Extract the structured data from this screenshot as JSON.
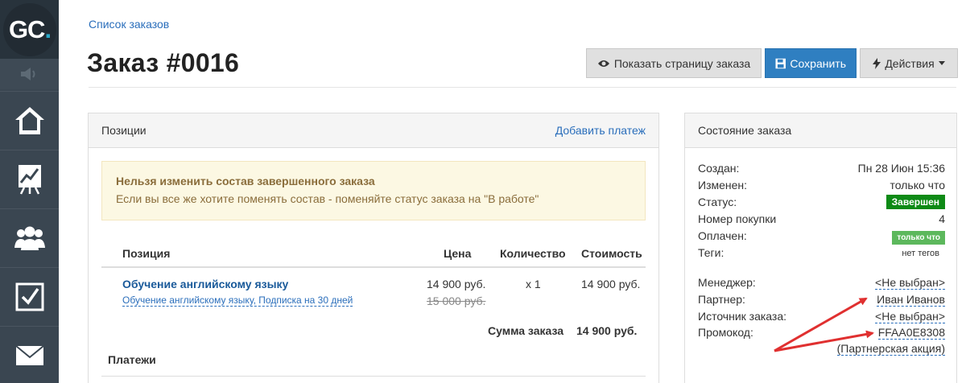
{
  "app": {
    "logo_text": "GC",
    "logo_dot": "."
  },
  "sidebar": {
    "items": [
      {
        "icon": "speaker-icon"
      },
      {
        "icon": "home-icon"
      },
      {
        "icon": "chart-icon"
      },
      {
        "icon": "users-icon"
      },
      {
        "icon": "checkbox-icon"
      },
      {
        "icon": "mail-icon"
      }
    ]
  },
  "header": {
    "breadcrumb": "Список заказов",
    "title": "Заказ #0016",
    "buttons": {
      "show_page": "Показать страницу заказа",
      "save": "Сохранить",
      "actions": "Действия"
    }
  },
  "positions_panel": {
    "title": "Позиции",
    "add_payment": "Добавить платеж",
    "alert_title": "Нельзя изменить состав завершенного заказа",
    "alert_text": "Если вы все же хотите поменять состав - поменяйте статус заказа на \"В работе\"",
    "columns": [
      "Позиция",
      "Цена",
      "Количество",
      "Стоимость"
    ],
    "rows": [
      {
        "title": "Обучение английскому языку",
        "subtitle": "Обучение английскому языку, Подписка на 30 дней",
        "price": "14 900 руб.",
        "old_price": "15 000 руб.",
        "quantity": "x 1",
        "cost": "14 900 руб."
      }
    ],
    "sum_label": "Сумма заказа",
    "sum_value": "14 900 руб.",
    "payments_label": "Платежи"
  },
  "state_panel": {
    "title": "Состояние заказа",
    "created_label": "Создан:",
    "created_value": "Пн 28 Июн 15:36",
    "changed_label": "Изменен:",
    "changed_value": "только что",
    "status_label": "Статус:",
    "status_value": "Завершен",
    "purchase_label": "Номер покупки",
    "purchase_value": "4",
    "paid_label": "Оплачен:",
    "paid_value": "только что",
    "tags_label": "Теги:",
    "tags_value": "нет тегов",
    "manager_label": "Менеджер:",
    "manager_value": "<Не выбран>",
    "partner_label": "Партнер:",
    "partner_value": "Иван Иванов",
    "source_label": "Источник заказа:",
    "source_value": "<Не выбран>",
    "promo_label": "Промокод:",
    "promo_value": "FFAA0E8308",
    "promo_note": "(Партнерская акция)",
    "status_color": "#0e8a16",
    "paid_color": "#5cb85c"
  },
  "annotations": {
    "arrow_color": "#e03030"
  }
}
